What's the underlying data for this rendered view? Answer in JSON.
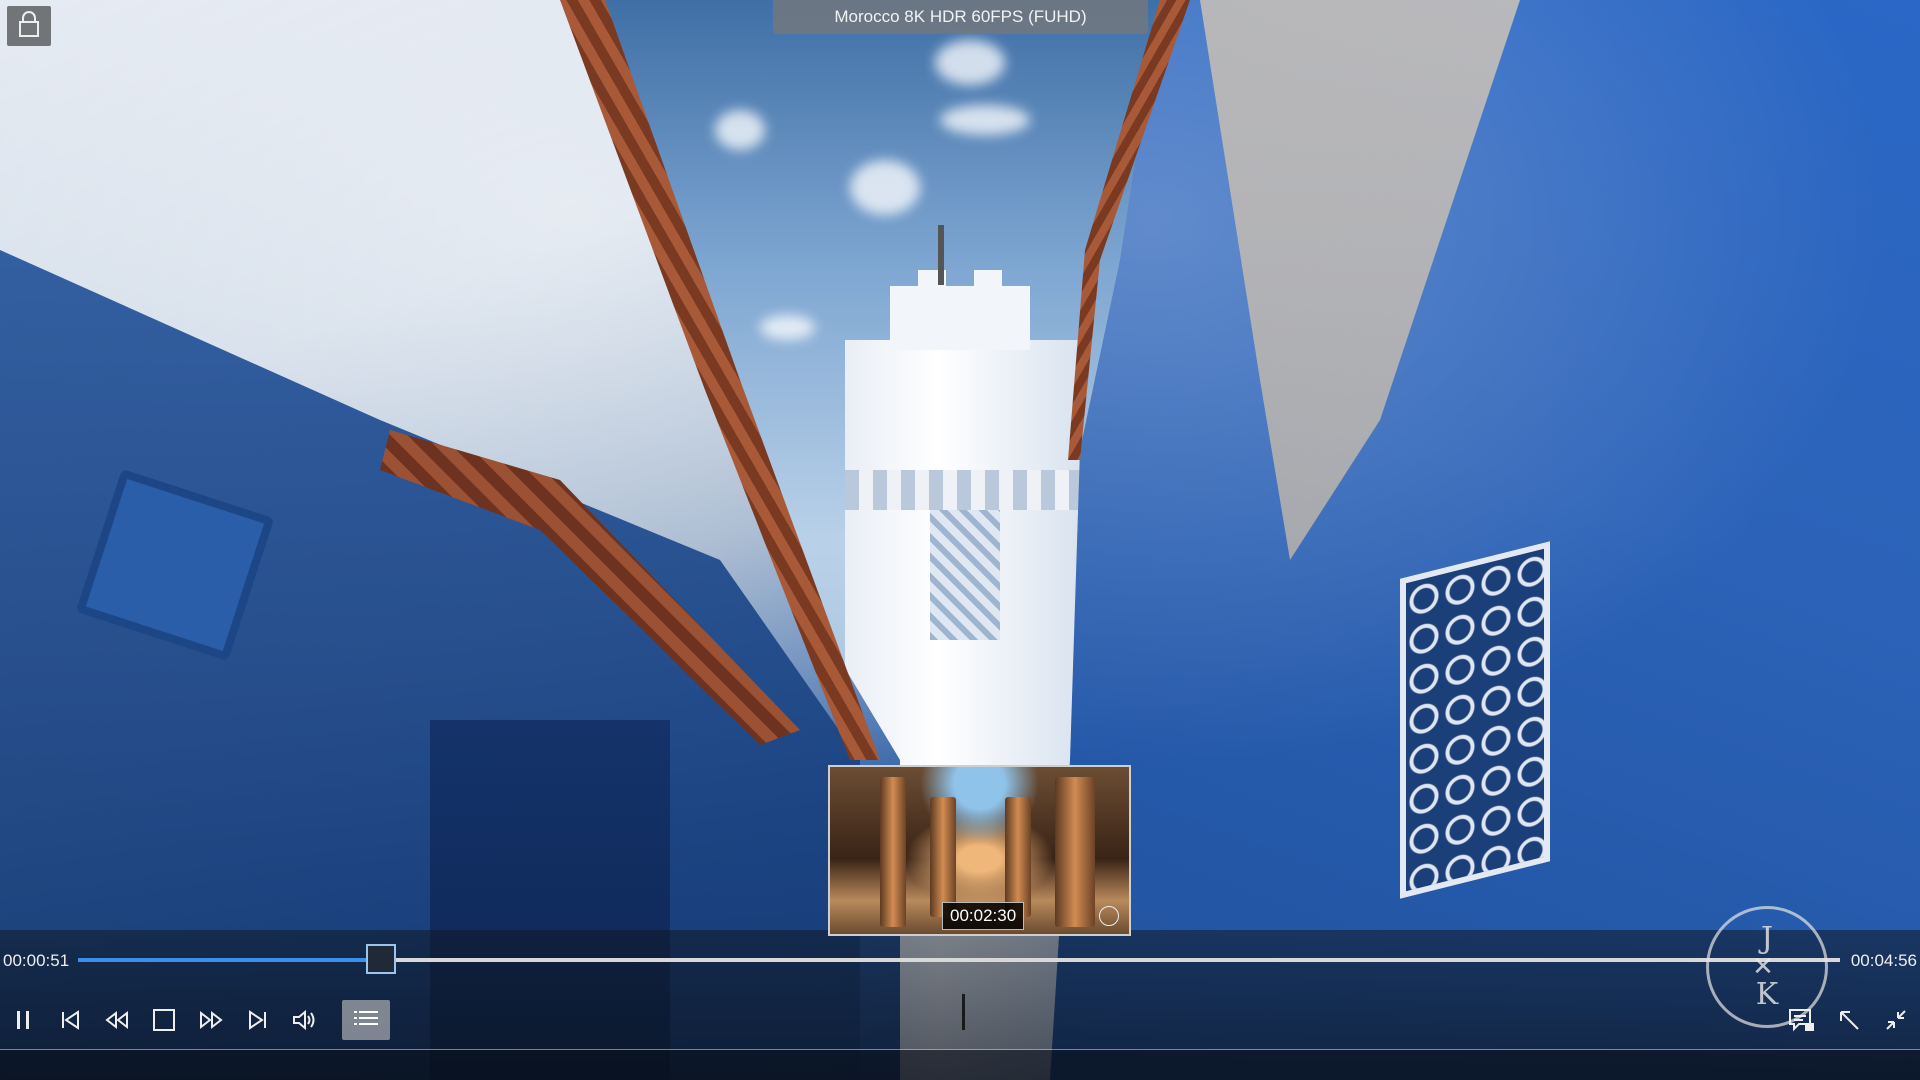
{
  "window": {
    "title": "Morocco 8K HDR 60FPS (FUHD)"
  },
  "player": {
    "current_time": "00:00:51",
    "total_time": "00:04:56",
    "progress": 0.172,
    "preview_time": "00:02:30",
    "watermark": {
      "top": "J",
      "bottom": "K"
    }
  },
  "controls": {
    "left": [
      "pause-icon",
      "previous-icon",
      "rewind-icon",
      "stop-icon",
      "fast-forward-icon",
      "next-icon",
      "volume-icon",
      "playlist-icon"
    ],
    "right": [
      "subtitles-icon",
      "restore-icon",
      "exit-fullscreen-icon"
    ]
  },
  "colors": {
    "accent": "#3b8fe6",
    "track": "#d8d8d8"
  }
}
